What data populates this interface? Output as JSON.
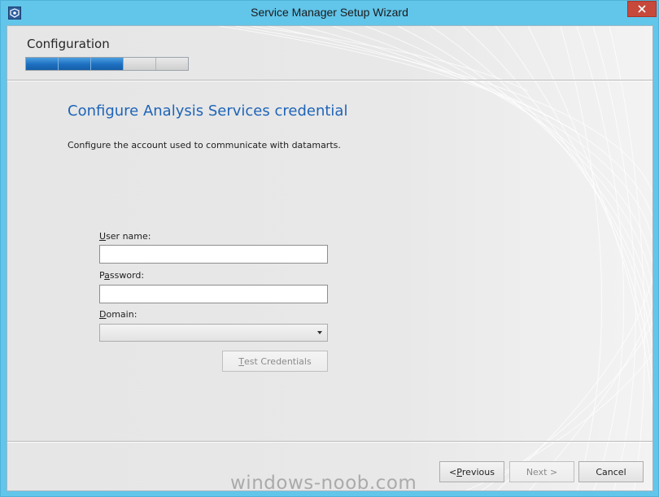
{
  "window": {
    "title": "Service Manager Setup Wizard",
    "accent_color": "#62c5ea",
    "close_color": "#c7493c"
  },
  "header": {
    "step_title": "Configuration",
    "progress": {
      "completed_steps": 3,
      "total_steps": 5,
      "fill_color": "#1d6fc0"
    }
  },
  "page": {
    "heading": "Configure Analysis Services credential",
    "description": "Configure the account used to communicate with datamarts.",
    "heading_color": "#1e64b8"
  },
  "form": {
    "username": {
      "label_prefix": "",
      "label_access_key": "U",
      "label_rest": "ser name:",
      "value": ""
    },
    "password": {
      "label_prefix": "P",
      "label_access_key": "a",
      "label_rest": "ssword:",
      "value": ""
    },
    "domain": {
      "label_prefix": "",
      "label_access_key": "D",
      "label_rest": "omain:",
      "value": ""
    },
    "test_button": {
      "access_key": "T",
      "rest": "est Credentials"
    }
  },
  "footer": {
    "previous": {
      "prefix": "< ",
      "access_key": "P",
      "rest": "revious"
    },
    "next": {
      "label": "Next >"
    },
    "cancel": {
      "label": "Cancel"
    }
  },
  "watermark": "windows-noob.com"
}
